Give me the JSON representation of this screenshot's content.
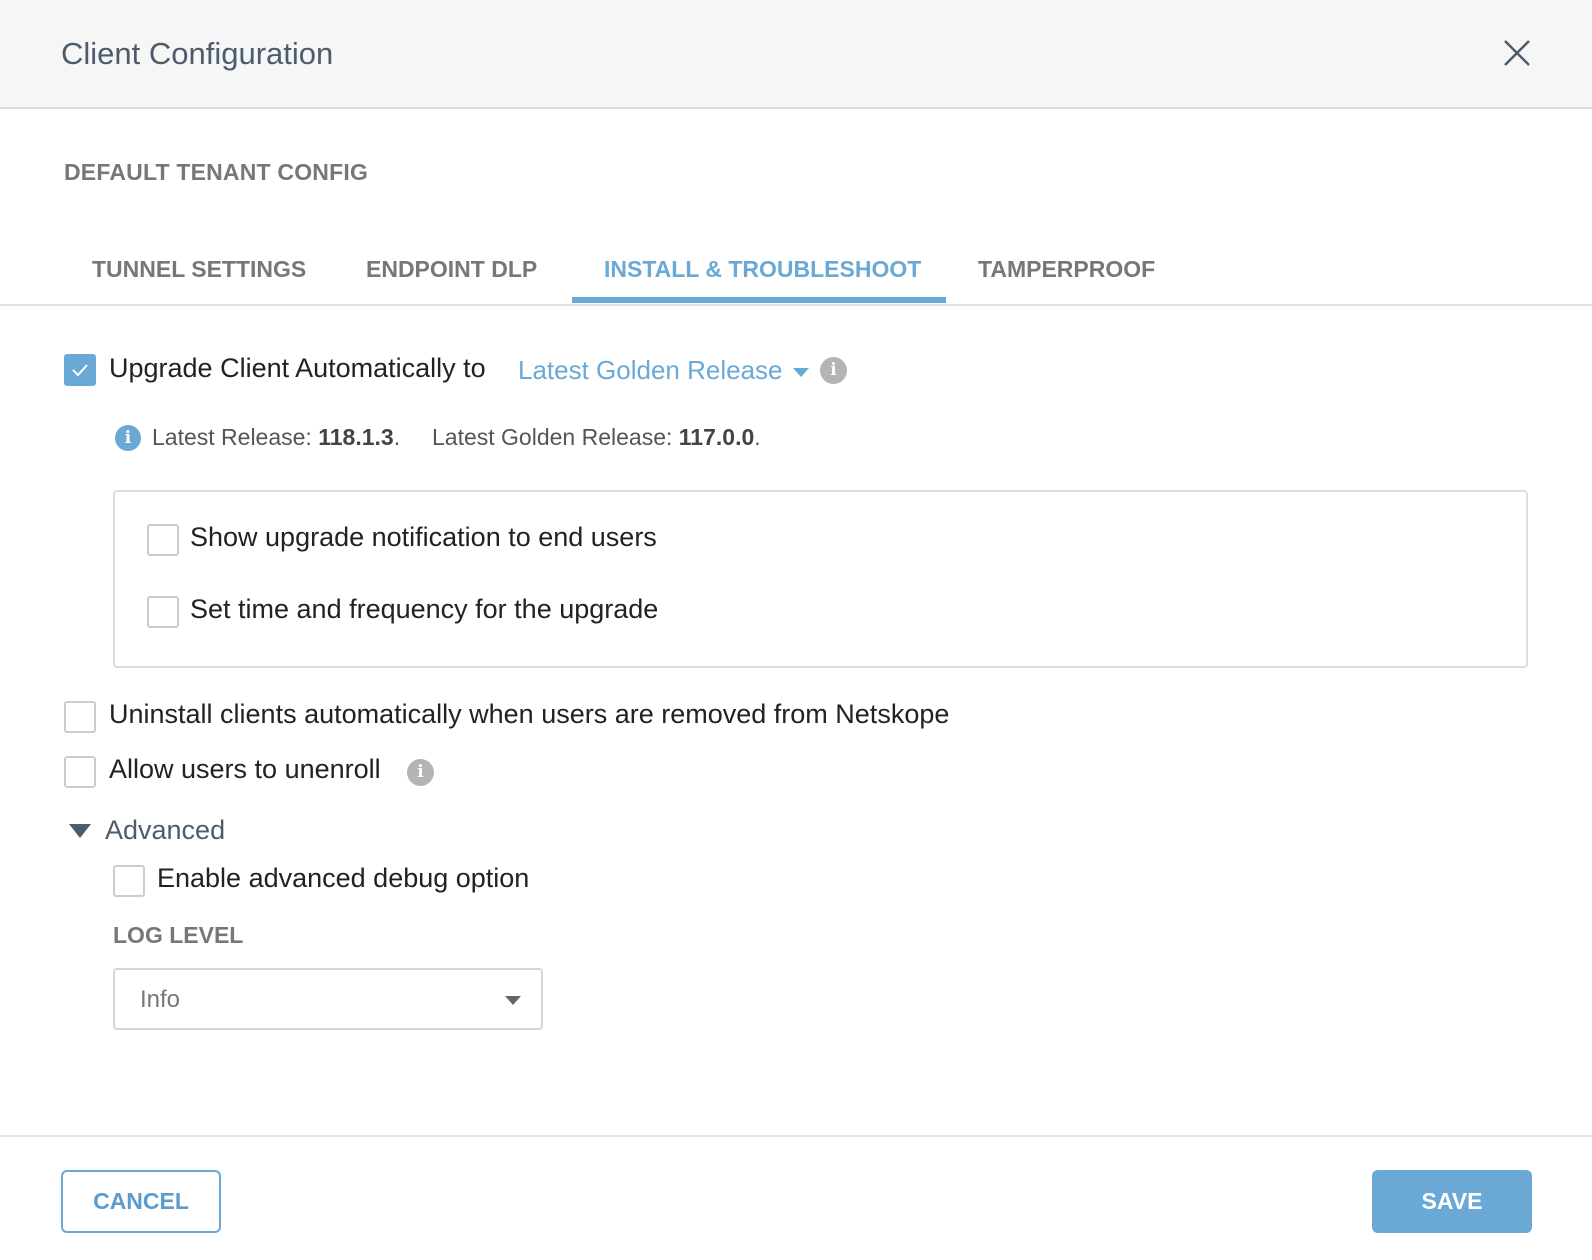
{
  "header": {
    "title": "Client Configuration",
    "close_icon": "close-icon"
  },
  "section_title": "DEFAULT TENANT CONFIG",
  "tabs": [
    {
      "label": "TUNNEL SETTINGS",
      "active": false
    },
    {
      "label": "ENDPOINT DLP",
      "active": false
    },
    {
      "label": "INSTALL & TROUBLESHOOT",
      "active": true
    },
    {
      "label": "TAMPERPROOF",
      "active": false
    }
  ],
  "upgrade": {
    "label": "Upgrade Client Automatically to",
    "checked": true,
    "release_option": "Latest Golden Release"
  },
  "release_info": {
    "latest_label": "Latest Release:",
    "latest_value": "118.1.3",
    "golden_label": "Latest Golden Release:",
    "golden_value": "117.0.0"
  },
  "upgrade_options": [
    {
      "label": "Show upgrade notification to end users",
      "checked": false
    },
    {
      "label": "Set time and frequency for the upgrade",
      "checked": false
    }
  ],
  "uninstall": {
    "label": "Uninstall clients automatically when users are removed from Netskope",
    "checked": false
  },
  "unenroll": {
    "label": "Allow users to unenroll",
    "checked": false
  },
  "advanced": {
    "label": "Advanced",
    "expanded": true,
    "debug_label": "Enable advanced debug option",
    "debug_checked": false,
    "log_level_label": "LOG LEVEL",
    "log_level_value": "Info"
  },
  "footer": {
    "cancel": "CANCEL",
    "save": "SAVE"
  },
  "colors": {
    "accent": "#6aa8d6",
    "header_bg": "#f6f6f6"
  }
}
